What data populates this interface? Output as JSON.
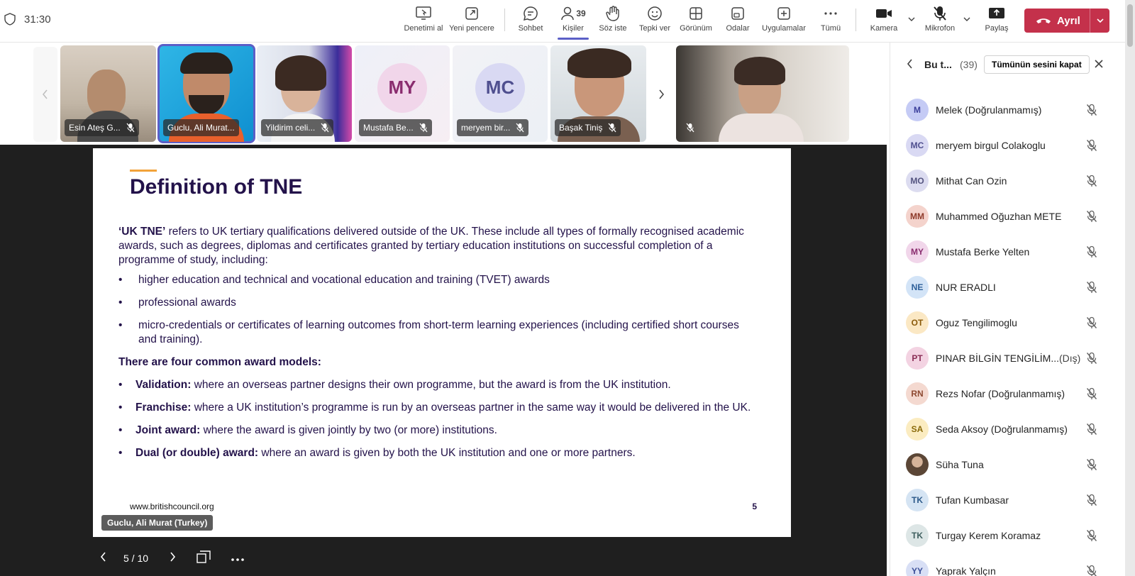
{
  "meeting": {
    "timer": "31:30"
  },
  "toolbar": {
    "items": [
      {
        "label": "Denetimi al"
      },
      {
        "label": "Yeni pencere"
      },
      {
        "label": "Sohbet"
      },
      {
        "label": "Kişiler",
        "count": "39"
      },
      {
        "label": "Söz iste"
      },
      {
        "label": "Tepki ver"
      },
      {
        "label": "Görünüm"
      },
      {
        "label": "Odalar"
      },
      {
        "label": "Uygulamalar"
      },
      {
        "label": "Tümü"
      },
      {
        "label": "Kamera"
      },
      {
        "label": "Mikrofon"
      },
      {
        "label": "Paylaş"
      }
    ],
    "leave_label": "Ayrıl",
    "accent": "#5b5fc7",
    "leave_color": "#c4314b"
  },
  "strip": {
    "tiles": [
      {
        "name": "Esin Ateş G..."
      },
      {
        "name": "Guclu, Ali Murat..."
      },
      {
        "name": "Yildirim celi..."
      },
      {
        "name": "Mustafa Be...",
        "initials": "MY"
      },
      {
        "name": "meryem bir...",
        "initials": "MC"
      },
      {
        "name": "Başak Tiniş"
      },
      {
        "name": ""
      }
    ]
  },
  "slide": {
    "title": "Definition of TNE",
    "intro_term": "‘UK TNE’",
    "intro_text": " refers to UK tertiary qualifications delivered outside of the UK. These include all types of formally recognised academic awards, such as degrees, diplomas and certificates granted by tertiary education institutions on successful completion of a programme of study, including:",
    "bullets": [
      "higher education and technical and vocational education and training (TVET) awards",
      "professional awards",
      "micro-credentials or certificates of learning outcomes from short-term learning experiences (including certified short courses and training)."
    ],
    "models_heading": "There are four common award models:",
    "models": [
      {
        "term": "Validation:",
        "text": " where an overseas partner designs their own programme, but the award is from the UK institution."
      },
      {
        "term": "Franchise:",
        "text": " where a UK institution’s programme is run by an overseas partner in the same way it would be delivered in the UK."
      },
      {
        "term": "Joint award:",
        "text": " where the award is given jointly by two (or more) institutions."
      },
      {
        "term": "Dual (or double) award:",
        "text": " where an award is given by both the UK institution and one or more partners."
      }
    ],
    "url": "www.britishcouncil.org",
    "page_number": "5",
    "presenter_label": "Guclu, Ali Murat (Turkey)",
    "nav_position": "5 / 10"
  },
  "panel": {
    "title": "Bu t...",
    "count": "(39)",
    "mute_all_label": "Tümünün sesini kapat",
    "participants": [
      {
        "initials": "M",
        "name": "Melek (Doğrulanmamış)",
        "color": "#c5cbf5",
        "fg": "#3b3f9c"
      },
      {
        "initials": "MC",
        "name": "meryem birgul Colakoglu",
        "color": "#d9d9f3",
        "fg": "#4f4f8f"
      },
      {
        "initials": "MO",
        "name": "Mithat Can Ozin",
        "color": "#dcdcf0",
        "fg": "#555580"
      },
      {
        "initials": "MM",
        "name": "Muhammed Oğuzhan METE",
        "color": "#f4d3cc",
        "fg": "#8e3a2a"
      },
      {
        "initials": "MY",
        "name": "Mustafa Berke Yelten",
        "color": "#f1d6ea",
        "fg": "#8a2d6f"
      },
      {
        "initials": "NE",
        "name": "NUR ERADLI",
        "color": "#d3e4f7",
        "fg": "#2d5f99"
      },
      {
        "initials": "OT",
        "name": "Oguz Tengilimoglu",
        "color": "#fbe8c4",
        "fg": "#8a5a0a"
      },
      {
        "initials": "PT",
        "name": "PINAR BİLGİN TENGİLİM...",
        "ext": "(Dış)",
        "color": "#f3d3e2",
        "fg": "#8a2d55"
      },
      {
        "initials": "RN",
        "name": "Rezs Nofar (Doğrulanmamış)",
        "color": "#f4d9d0",
        "fg": "#8e4a32"
      },
      {
        "initials": "SA",
        "name": "Seda Aksoy (Doğrulanmamış)",
        "color": "#fbecc1",
        "fg": "#8a6a0a"
      },
      {
        "initials": "",
        "name": "Süha Tuna",
        "color": "#8a6d55",
        "fg": "#fff",
        "photo": true
      },
      {
        "initials": "TK",
        "name": "Tufan Kumbasar",
        "color": "#d5e4f3",
        "fg": "#2d5a8a"
      },
      {
        "initials": "TK",
        "name": "Turgay Kerem Koramaz",
        "color": "#dde6e6",
        "fg": "#3f5f5f"
      },
      {
        "initials": "YY",
        "name": "Yaprak Yalçın",
        "color": "#d8dff5",
        "fg": "#3b4f99"
      }
    ]
  }
}
